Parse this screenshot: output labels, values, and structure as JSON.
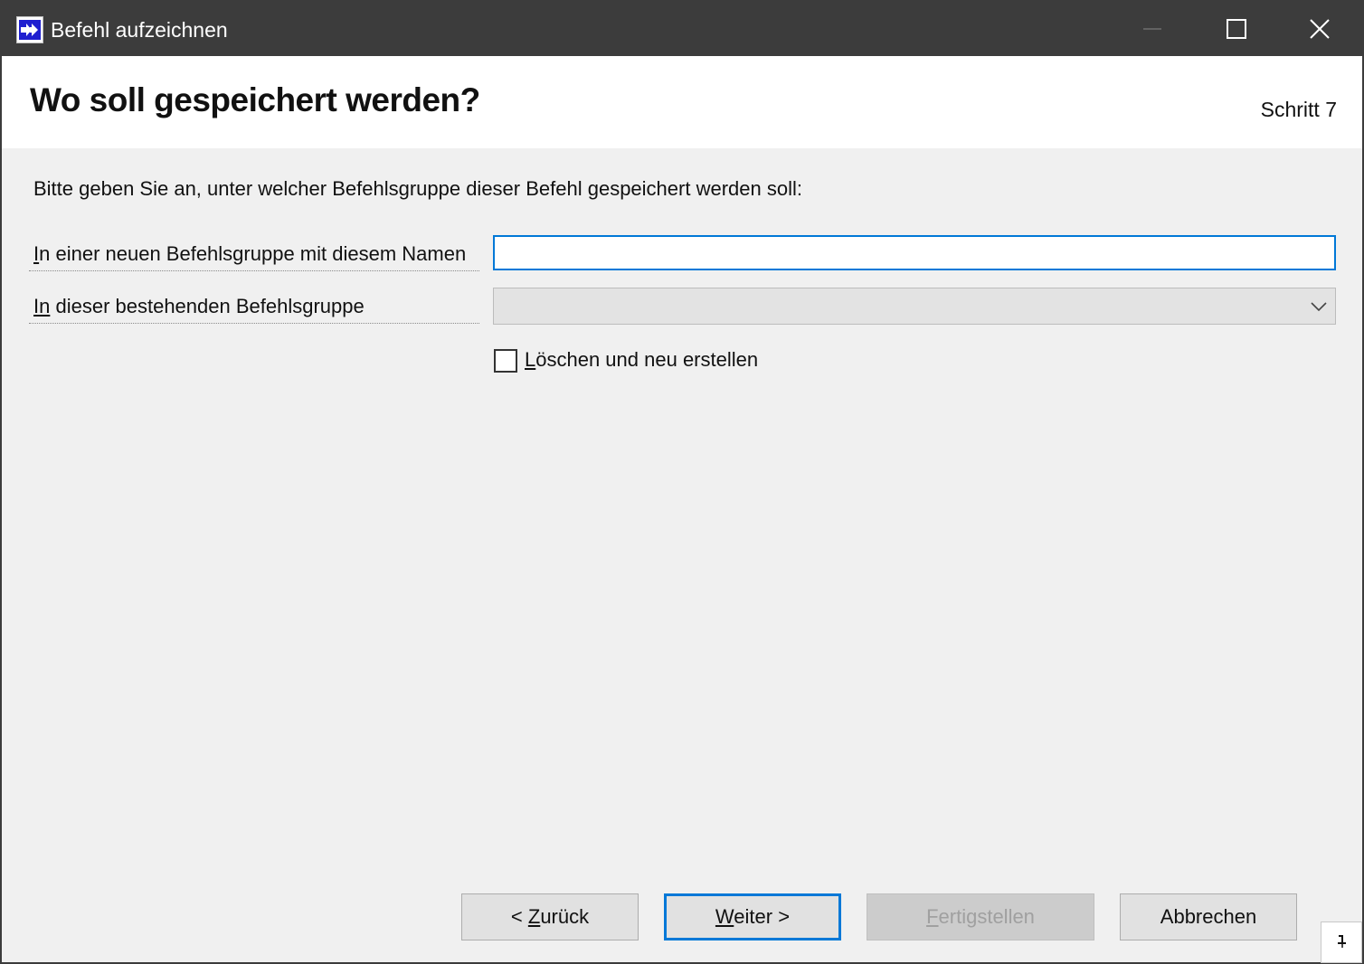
{
  "window": {
    "title": "Befehl aufzeichnen",
    "app_icon": "double-arrow-right-icon",
    "controls": [
      "minimize-icon",
      "maximize-icon",
      "close-icon"
    ]
  },
  "header": {
    "title": "Wo soll gespeichert werden?",
    "step": "Schritt 7"
  },
  "form": {
    "intro": "Bitte geben Sie an, unter welcher Befehlsgruppe dieser Befehl gespeichert werden soll:",
    "new_group": {
      "label_accel": "I",
      "label_rest": "n einer neuen Befehlsgruppe mit diesem Namen",
      "value": ""
    },
    "existing_group": {
      "label_accel": "In",
      "label_rest": " dieser bestehenden Befehlsgruppe",
      "selected": ""
    },
    "recreate": {
      "checked": false,
      "label_accel": "L",
      "label_rest": "öschen und neu erstellen"
    }
  },
  "buttons": {
    "back": {
      "prefix": "< ",
      "accel": "Z",
      "rest": "urück"
    },
    "next": {
      "accel": "W",
      "rest": "eiter >"
    },
    "finish": {
      "accel": "F",
      "rest": "ertigstellen",
      "enabled": false
    },
    "cancel": {
      "label": "Abbrechen"
    }
  },
  "colors": {
    "titlebar": "#3c3c3c",
    "focus_accent": "#0078d7",
    "app_icon_blue": "#1f1fd0"
  }
}
